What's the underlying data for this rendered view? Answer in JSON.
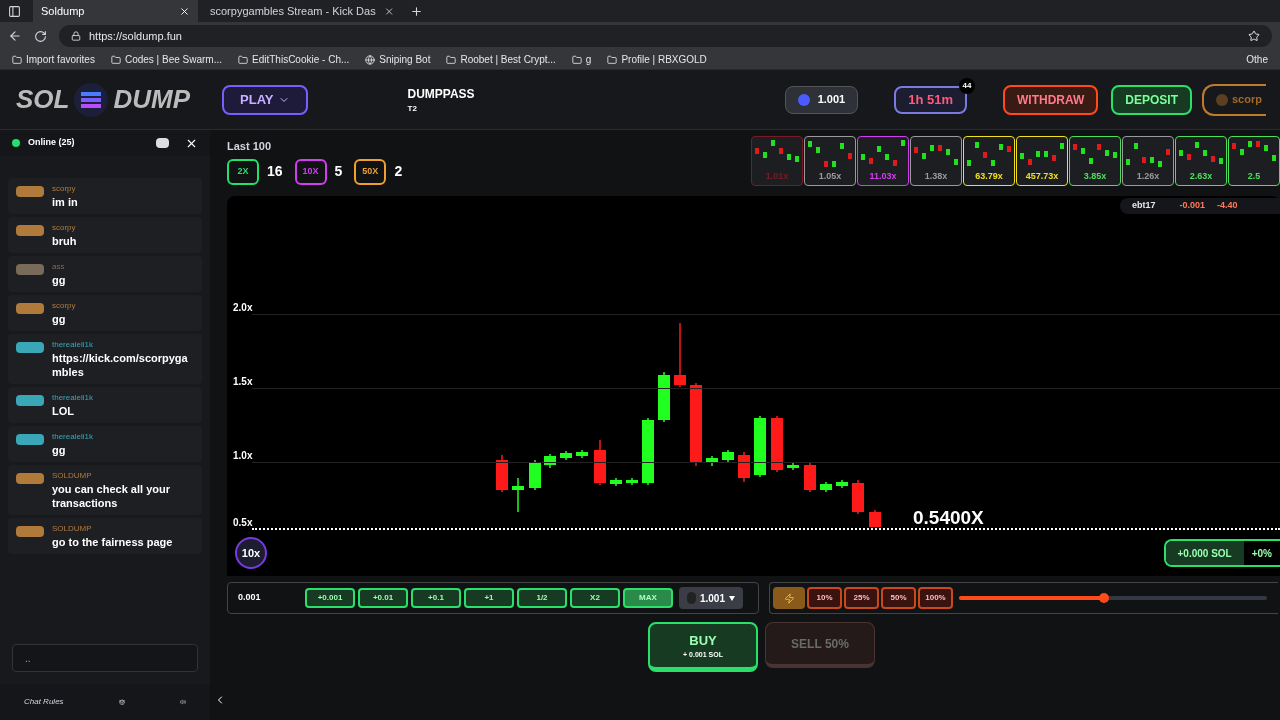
{
  "browser": {
    "tabs": [
      {
        "title": "Soldump",
        "selected": true
      },
      {
        "title": "scorpygambles Stream - Kick Das",
        "selected": false
      }
    ],
    "url": "https://soldump.fun",
    "bookmarks": [
      "Import favorites",
      "Codes | Bee Swarm...",
      "EditThisCookie - Ch...",
      "Sniping Bot",
      "Roobet | Best Crypt...",
      "g",
      "Profile | RBXGOLD"
    ],
    "bookmarks_overflow": "Othe"
  },
  "header": {
    "logo_left": "SOL",
    "logo_right": "DUMP",
    "play": "PLAY",
    "dumppass": {
      "title": "DUMPPASS",
      "tier": "T2"
    },
    "balance": "1.001",
    "timer": "1h 51m",
    "timer_badge": "44",
    "withdraw": "WITHDRAW",
    "deposit": "DEPOSIT",
    "profile": "scorp"
  },
  "chat": {
    "online": "Online (25)",
    "messages": [
      {
        "user": "scorpy",
        "text": "im in",
        "color": "#b07a3a"
      },
      {
        "user": "scorpy",
        "text": "bruh",
        "color": "#b07a3a"
      },
      {
        "user": "ass",
        "text": "gg",
        "color": "#7a6a5a"
      },
      {
        "user": "scorpy",
        "text": "gg",
        "color": "#b07a3a"
      },
      {
        "user": "therealeli1k",
        "text": "https://kick.com/scorpygambles",
        "color": "#3aa7b8"
      },
      {
        "user": "therealeli1k",
        "text": "LOL",
        "color": "#3aa7b8"
      },
      {
        "user": "therealeli1k",
        "text": "gg",
        "color": "#3aa7b8"
      },
      {
        "user": "SOLDUMP",
        "text": "you can check all your transactions",
        "color": "#b07a3a"
      },
      {
        "user": "SOLDUMP",
        "text": "go to the fairness page",
        "color": "#b07a3a"
      }
    ],
    "input_placeholder": "..",
    "rules": "Chat Rules"
  },
  "stats": {
    "title": "Last 100",
    "items": [
      {
        "label": "2X",
        "count": "16",
        "color": "#22e06a"
      },
      {
        "label": "10X",
        "count": "5",
        "color": "#d43cf0"
      },
      {
        "label": "50X",
        "count": "2",
        "color": "#f0a030"
      }
    ]
  },
  "history": [
    {
      "value": "1.01x",
      "color": "#7a1a22"
    },
    {
      "value": "1.05x",
      "color": "#9a9a9a"
    },
    {
      "value": "11.03x",
      "color": "#d43cf0"
    },
    {
      "value": "1.38x",
      "color": "#9a9a9a"
    },
    {
      "value": "63.79x",
      "color": "#f0e020"
    },
    {
      "value": "457.73x",
      "color": "#f0e020"
    },
    {
      "value": "3.85x",
      "color": "#4ae05a"
    },
    {
      "value": "1.26x",
      "color": "#9a9a9a"
    },
    {
      "value": "2.63x",
      "color": "#4ae05a"
    },
    {
      "value": "2.5",
      "color": "#4ae05a"
    }
  ],
  "leaderboard": {
    "user": "ebt17",
    "amount": "-0.001",
    "percent": "-4.40"
  },
  "chart": {
    "y_labels": [
      "2.0x",
      "1.5x",
      "1.0x",
      "0.5x"
    ],
    "multiplier": "0.5400X",
    "badge": "10x",
    "profit": "+0.000 SOL",
    "profit_percent": "+0%"
  },
  "bet": {
    "amount": "0.001",
    "buttons": [
      {
        "label": "+0.001",
        "selected": false
      },
      {
        "label": "+0.01",
        "selected": false
      },
      {
        "label": "+0.1",
        "selected": false
      },
      {
        "label": "+1",
        "selected": false
      },
      {
        "label": "1/2",
        "selected": false
      },
      {
        "label": "X2",
        "selected": false
      },
      {
        "label": "MAX",
        "selected": true
      }
    ],
    "balance": "1.001",
    "buy": "BUY",
    "buy_sub": "+ 0.001 SOL"
  },
  "sell": {
    "percents": [
      "10%",
      "25%",
      "50%",
      "100%"
    ],
    "level": 0.47,
    "button": "SELL 50%",
    "disabled": true
  }
}
